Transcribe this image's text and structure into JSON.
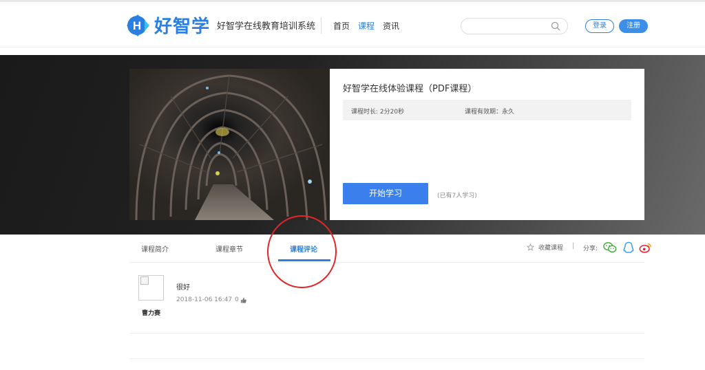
{
  "header": {
    "brand": "好智学",
    "subtitle": "好智学在线教育培训系统",
    "nav": [
      {
        "label": "首页",
        "active": false
      },
      {
        "label": "课程",
        "active": true
      },
      {
        "label": "资讯",
        "active": false
      }
    ],
    "search": {
      "value": "",
      "placeholder": ""
    },
    "login_label": "登录",
    "register_label": "注册"
  },
  "course": {
    "title": "好智学在线体验课程（PDF课程）",
    "duration": "课程时长: 2分20秒",
    "validity": "课程有效期：永久",
    "start_label": "开始学习",
    "learners": "(已有7人学习)"
  },
  "tabs": [
    {
      "label": "课程简介",
      "active": false
    },
    {
      "label": "课程章节",
      "active": false
    },
    {
      "label": "课程评论",
      "active": true
    }
  ],
  "actions": {
    "favorite_label": "收藏课程",
    "separator": "|",
    "share_label": "分享:"
  },
  "comments": [
    {
      "user": "曹力赛",
      "text": "很好",
      "time": "2018-11-06 16:47",
      "likes": "0"
    }
  ],
  "colors": {
    "accent": "#2a7fe0",
    "annotation": "#e0262a",
    "wechat": "#3cb035",
    "qq": "#3a9ee8",
    "weibo": "#e6162d"
  },
  "icons": [
    "logo-h-icon",
    "search-icon",
    "star-icon",
    "wechat-icon",
    "qq-icon",
    "weibo-icon",
    "thumbs-up-icon",
    "broken-image-icon"
  ]
}
